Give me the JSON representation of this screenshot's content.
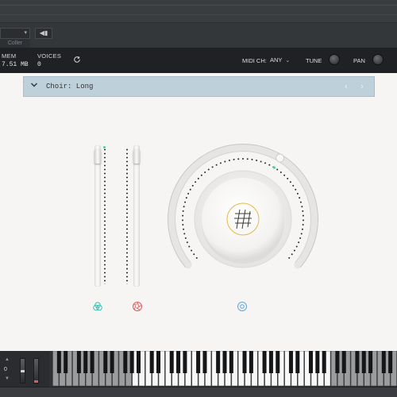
{
  "host": {
    "preset_dropdown_value": "",
    "preset_tab_label": "Coller",
    "nav_button_label": "◀▮"
  },
  "header": {
    "mem_label": "MEM",
    "mem_value": "7.51 MB",
    "voices_label": "VOICES",
    "voices_value": "0",
    "midi_label": "MIDI CH:",
    "midi_value": "ANY",
    "tune_label": "TUNE",
    "pan_label": "PAN"
  },
  "preset": {
    "name": "Choir: Long",
    "prev_arrow": "‹",
    "next_arrow": "›"
  },
  "controls": {
    "slider_1_level": 0.97,
    "slider_2_level": 0.97,
    "main_knob_level": 0.62
  },
  "keyboard": {
    "octave": "0",
    "active_white_range_start": 12,
    "active_white_range_end": 41
  },
  "colors": {
    "accent_green": "#4bd19a",
    "teal_icon": "#3bbfb1",
    "red_icon": "#e05a5a",
    "blue_icon": "#5da6d6",
    "knob_logo": "#e7b84a",
    "preset_bar": "#bed0da"
  }
}
